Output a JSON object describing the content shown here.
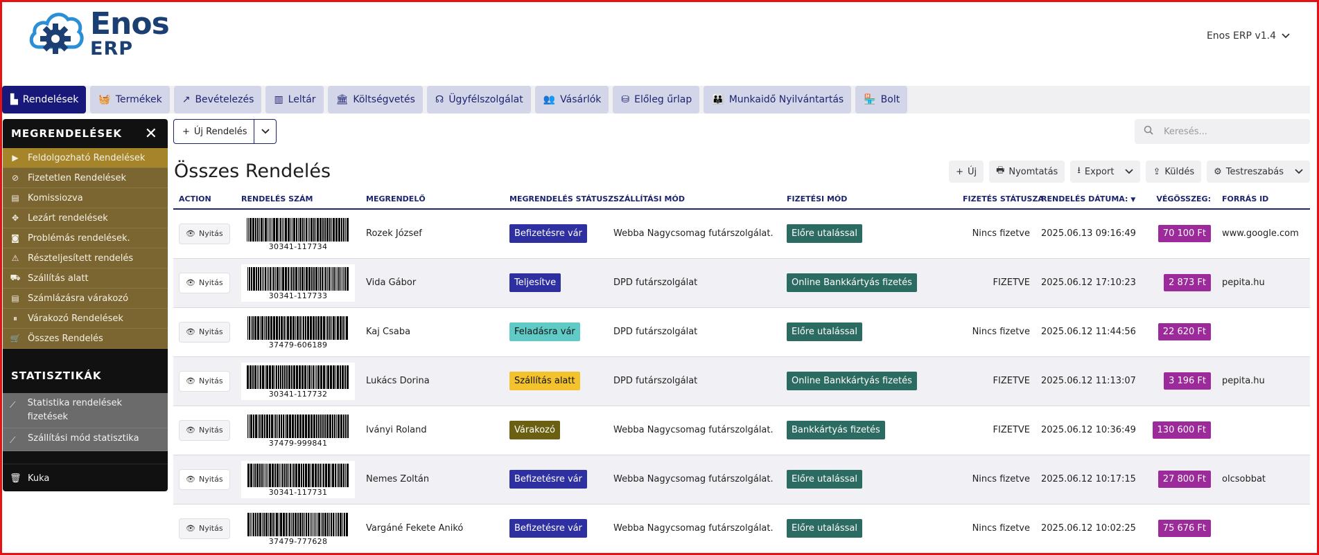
{
  "app": {
    "logo_line1": "Enos",
    "logo_line2": "ERP",
    "version": "Enos ERP v1.4"
  },
  "tabs": [
    {
      "label": "Rendelések",
      "icon": "warehouse-icon",
      "active": true
    },
    {
      "label": "Termékek",
      "icon": "basket-icon",
      "active": false
    },
    {
      "label": "Bevételezés",
      "icon": "trend-up-icon",
      "active": false
    },
    {
      "label": "Leltár",
      "icon": "barcode-icon",
      "active": false
    },
    {
      "label": "Költségvetés",
      "icon": "bank-icon",
      "active": false
    },
    {
      "label": "Ügyfélszolgálat",
      "icon": "headset-icon",
      "active": false
    },
    {
      "label": "Vásárlók",
      "icon": "users-icon",
      "active": false
    },
    {
      "label": "Előleg űrlap",
      "icon": "coins-icon",
      "active": false
    },
    {
      "label": "Munkaidő Nyilvántartás",
      "icon": "people-group-icon",
      "active": false
    },
    {
      "label": "Bolt",
      "icon": "store-icon",
      "active": false
    }
  ],
  "sidebar": {
    "title": "MEGRENDELÉSEK",
    "items": [
      {
        "label": "Feldolgozható Rendelések",
        "icon": "play-icon",
        "highlight": true
      },
      {
        "label": "Fizetetlen Rendelések",
        "icon": "ban-icon",
        "highlight": false
      },
      {
        "label": "Komissiozva",
        "icon": "boxes-icon",
        "highlight": false
      },
      {
        "label": "Lezárt rendelések",
        "icon": "move-icon",
        "highlight": false
      },
      {
        "label": "Problémás rendelések.",
        "icon": "camera-icon",
        "highlight": false
      },
      {
        "label": "Részteljesített rendelés",
        "icon": "warning-icon",
        "highlight": false
      },
      {
        "label": "Szállítás alatt",
        "icon": "truck-icon",
        "highlight": false
      },
      {
        "label": "Számlázásra várakozó",
        "icon": "invoice-icon",
        "highlight": false
      },
      {
        "label": "Várakozó Rendelések",
        "icon": "pause-icon",
        "highlight": false
      },
      {
        "label": "Összes Rendelés",
        "icon": "cart-icon",
        "highlight": false
      }
    ],
    "stats_title": "STATISZTIKÁK",
    "stats": [
      {
        "label": "Statistika rendelések fizetések",
        "icon": "chart-line-icon"
      },
      {
        "label": "Szállítási mód statisztika",
        "icon": "chart-line-icon"
      }
    ],
    "trash": "Kuka"
  },
  "toolbar": {
    "new_label": "Új Rendelés",
    "search_placeholder": "Keresés...",
    "page_title": "Összes Rendelés",
    "actions": {
      "new": "Új",
      "print": "Nyomtatás",
      "export": "Export",
      "send": "Küldés",
      "customize": "Testreszabás"
    }
  },
  "table": {
    "columns": [
      "ACTION",
      "RENDELÉS SZÁM",
      "MEGRENDELŐ",
      "MEGRENDELÉS STÁTUSZ:",
      "SZÁLLÍTÁSI MÓD",
      "FIZETÉSI MÓD",
      "FIZETÉS STÁTUSZA",
      "RENDELÉS DÁTUMA:",
      "VÉGÖSSZEG:",
      "FORRÁS ID"
    ],
    "open_label": "Nyitás",
    "rows": [
      {
        "barcode": "30341-117734",
        "customer": "Rozek József",
        "status": "Befizetésre vár",
        "status_color": "#2e2fa0",
        "status_text_color": "#ffffff",
        "shipping": "Webba Nagycsomag futárszolgálat.",
        "payment": "Előre utalással",
        "payment_status": "Nincs fizetve",
        "date": "2025.06.13 09:16:49",
        "total": "70 100 Ft",
        "source": "www.google.com"
      },
      {
        "barcode": "30341-117733",
        "customer": "Vida Gábor",
        "status": "Teljesítve",
        "status_color": "#2e2fa0",
        "status_text_color": "#ffffff",
        "shipping": "DPD futárszolgálat",
        "payment": "Online Bankkártyás fizetés",
        "payment_status": "FIZETVE",
        "date": "2025.06.12 17:10:23",
        "total": "2 873 Ft",
        "source": "pepita.hu"
      },
      {
        "barcode": "37479-606189",
        "customer": "Kaj Csaba",
        "status": "Feladásra vár",
        "status_color": "#5fcac6",
        "status_text_color": "#111111",
        "shipping": "DPD futárszolgálat",
        "payment": "Előre utalással",
        "payment_status": "Nincs fizetve",
        "date": "2025.06.12 11:44:56",
        "total": "22 620 Ft",
        "source": ""
      },
      {
        "barcode": "30341-117732",
        "customer": "Lukács Dorina",
        "status": "Szállítás alatt",
        "status_color": "#f3c22d",
        "status_text_color": "#111111",
        "shipping": "DPD futárszolgálat",
        "payment": "Online Bankkártyás fizetés",
        "payment_status": "FIZETVE",
        "date": "2025.06.12 11:13:07",
        "total": "3 196 Ft",
        "source": "pepita.hu"
      },
      {
        "barcode": "37479-999841",
        "customer": "Iványi Roland",
        "status": "Várakozó",
        "status_color": "#6b6012",
        "status_text_color": "#ffffff",
        "shipping": "Webba Nagycsomag futárszolgálat.",
        "payment": "Bankkártyás fizetés",
        "payment_status": "FIZETVE",
        "date": "2025.06.12 10:36:49",
        "total": "130 600 Ft",
        "source": ""
      },
      {
        "barcode": "30341-117731",
        "customer": "Nemes Zoltán",
        "status": "Befizetésre vár",
        "status_color": "#2e2fa0",
        "status_text_color": "#ffffff",
        "shipping": "Webba Nagycsomag futárszolgálat.",
        "payment": "Előre utalással",
        "payment_status": "Nincs fizetve",
        "date": "2025.06.12 10:17:15",
        "total": "27 800 Ft",
        "source": "olcsobbat"
      },
      {
        "barcode": "37479-777628",
        "customer": "Vargáné Fekete Anikó",
        "status": "Befizetésre vár",
        "status_color": "#2e2fa0",
        "status_text_color": "#ffffff",
        "shipping": "Webba Nagycsomag futárszolgálat.",
        "payment": "Előre utalással",
        "payment_status": "Nincs fizetve",
        "date": "2025.06.12 10:02:25",
        "total": "75 676 Ft",
        "source": ""
      }
    ]
  },
  "colors": {
    "primary": "#17187a",
    "tab_bg": "#d3d5e8",
    "sidebar_item": "#7b6632",
    "sidebar_highlight": "#a5842a",
    "payment_badge": "#2c6b61",
    "total_badge": "#9c2a9a"
  }
}
